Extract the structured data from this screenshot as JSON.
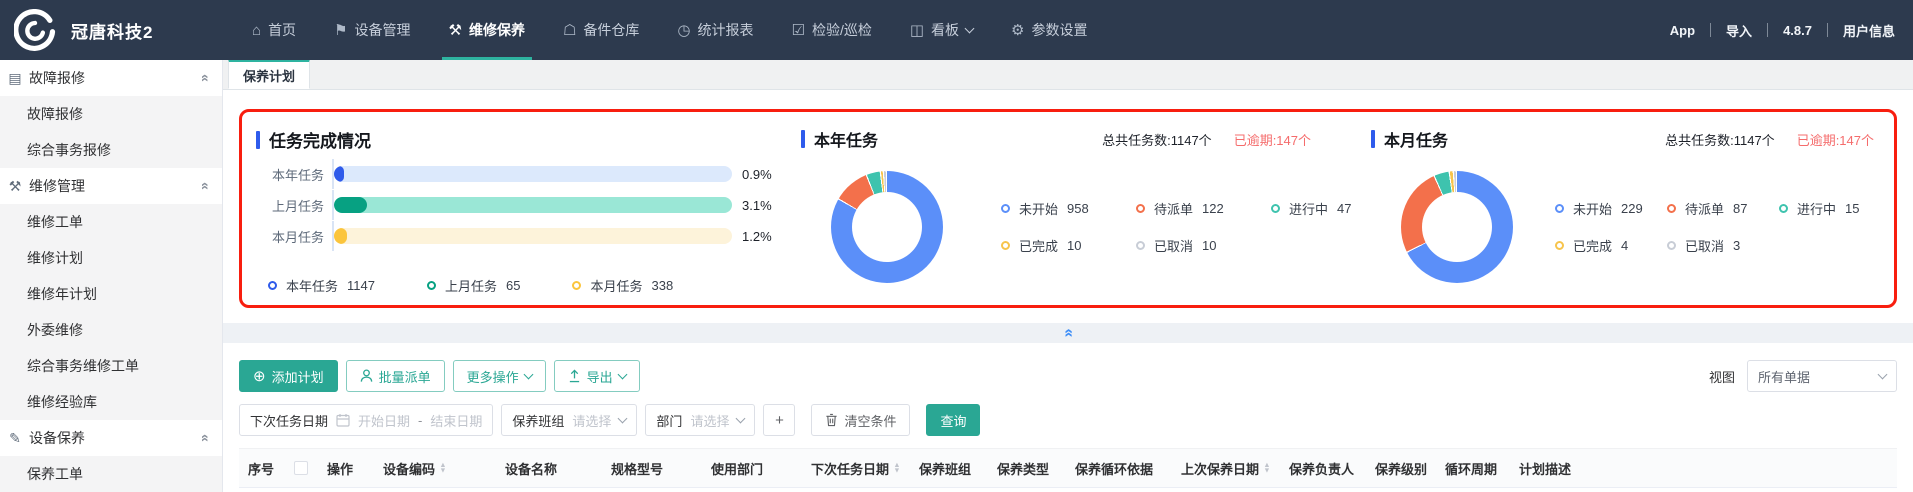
{
  "navbar": {
    "brand": "冠唐科技2",
    "items": [
      {
        "label": "首页",
        "icon": "home-icon"
      },
      {
        "label": "设备管理",
        "icon": "equipment-icon"
      },
      {
        "label": "维修保养",
        "icon": "tools-icon",
        "active": true
      },
      {
        "label": "备件仓库",
        "icon": "warehouse-icon"
      },
      {
        "label": "统计报表",
        "icon": "report-icon"
      },
      {
        "label": "检验/巡检",
        "icon": "inspection-icon"
      },
      {
        "label": "看板",
        "icon": "board-icon",
        "caret": true
      },
      {
        "label": "参数设置",
        "icon": "settings-icon"
      }
    ],
    "right_items": [
      "App",
      "导入",
      "4.8.7",
      "用户信息"
    ]
  },
  "sidebar": {
    "groups": [
      {
        "label": "故障报修",
        "icon": "fault-report-icon",
        "items": [
          "故障报修",
          "综合事务报修"
        ]
      },
      {
        "label": "维修管理",
        "icon": "repair-manage-icon",
        "items": [
          "维修工单",
          "维修计划",
          "维修年计划",
          "外委维修",
          "综合事务维修工单",
          "维修经验库"
        ]
      },
      {
        "label": "设备保养",
        "icon": "device-maintain-icon",
        "items": [
          "保养工单"
        ]
      }
    ]
  },
  "tab": {
    "label": "保养计划"
  },
  "chart_data": [
    {
      "type": "bar",
      "orientation": "horizontal",
      "title": "任务完成情况",
      "categories": [
        "本年任务",
        "上月任务",
        "本月任务"
      ],
      "values": [
        0.9,
        3.1,
        1.2
      ],
      "unit": "%",
      "legend": [
        {
          "label": "本年任务",
          "value": 1147
        },
        {
          "label": "上月任务",
          "value": 65
        },
        {
          "label": "本月任务",
          "value": 338
        }
      ]
    },
    {
      "type": "pie",
      "title": "本年任务",
      "total_text": "总共任务数:1147个",
      "overdue_text": "已逾期:147个",
      "series": [
        {
          "name": "未开始",
          "value": 958
        },
        {
          "name": "待派单",
          "value": 122
        },
        {
          "name": "进行中",
          "value": 47
        },
        {
          "name": "已完成",
          "value": 10
        },
        {
          "name": "已取消",
          "value": 10
        }
      ]
    },
    {
      "type": "pie",
      "title": "本月任务",
      "total_text": "总共任务数:1147个",
      "overdue_text": "已逾期:147个",
      "series": [
        {
          "name": "未开始",
          "value": 229
        },
        {
          "name": "待派单",
          "value": 87
        },
        {
          "name": "进行中",
          "value": 15
        },
        {
          "name": "已完成",
          "value": 4
        },
        {
          "name": "已取消",
          "value": 3
        }
      ]
    }
  ],
  "toolbar": {
    "add_label": "添加计划",
    "batch_label": "批量派单",
    "more_label": "更多操作",
    "export_label": "导出",
    "view_label": "视图",
    "view_value": "所有单据"
  },
  "filters": {
    "date_label": "下次任务日期",
    "date_start_placeholder": "开始日期",
    "date_separator": "-",
    "date_end_placeholder": "结束日期",
    "team_label": "保养班组",
    "team_placeholder": "请选择",
    "dept_label": "部门",
    "dept_placeholder": "请选择",
    "add_condition_label": "+",
    "clear_label": "清空条件",
    "query_label": "查询"
  },
  "table": {
    "columns": [
      {
        "label": "序号"
      },
      {
        "label": "",
        "checkbox": true
      },
      {
        "label": "操作"
      },
      {
        "label": "设备编码",
        "sortable": true
      },
      {
        "label": "设备名称"
      },
      {
        "label": "规格型号"
      },
      {
        "label": "使用部门"
      },
      {
        "label": "下次任务日期",
        "sortable": true
      },
      {
        "label": "保养班组"
      },
      {
        "label": "保养类型"
      },
      {
        "label": "保养循环依据"
      },
      {
        "label": "上次保养日期",
        "sortable": true
      },
      {
        "label": "保养负责人"
      },
      {
        "label": "保养级别"
      },
      {
        "label": "循环周期"
      },
      {
        "label": "计划描述"
      }
    ]
  },
  "colors": {
    "theme_teal": "#2AA794",
    "nav_active_underline": "#2EB3A0",
    "panel_border_red": "#F81E0F",
    "overdue_red": "#F56C6C",
    "title_accent_blue": "#2E5BEC",
    "status": {
      "未开始": "#5B8FF9",
      "待派单": "#F3704B",
      "进行中": "#3EC3AE",
      "已完成": "#F7C44C",
      "已取消": "#C8CDD6"
    },
    "bars": [
      {
        "fill": "#2F5BEA",
        "track": "#DCE9FC"
      },
      {
        "fill": "#07A182",
        "track": "#9AE7D6"
      },
      {
        "fill": "#FBC53D",
        "track": "#FDF3DA"
      }
    ]
  },
  "icon_glyphs": {
    "home-icon": "⌂",
    "equipment-icon": "⚑",
    "tools-icon": "⚒",
    "warehouse-icon": "☖",
    "report-icon": "◷",
    "inspection-icon": "☑",
    "board-icon": "◫",
    "settings-icon": "⚙",
    "fault-report-icon": "▤",
    "repair-manage-icon": "⚒",
    "device-maintain-icon": "✎",
    "add-icon": "⊕"
  }
}
